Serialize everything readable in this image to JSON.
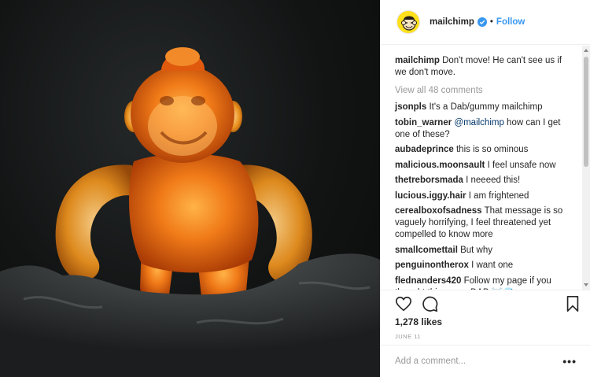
{
  "post": {
    "username": "mailchimp",
    "follow_label": "Follow",
    "dot": "•",
    "caption": {
      "user": "mailchimp",
      "text": " Don't move! He can't see us if we don't move."
    },
    "view_all": "View all 48 comments",
    "comments": [
      {
        "user": "jsonpls",
        "text": " It's a Dab/gummy mailchimp"
      },
      {
        "user": "tobin_warner",
        "mention": " @mailchimp",
        "text": " how can I get one of these?"
      },
      {
        "user": "aubadeprince",
        "text": " this is so ominous"
      },
      {
        "user": "malicious.moonsault",
        "text": " I feel unsafe now"
      },
      {
        "user": "thetrebors​mada",
        "text": " I neeeed this!"
      },
      {
        "user": "lucious.iggy.hair",
        "text": " I am frightened"
      },
      {
        "user": "cerealboxofsadness",
        "text": " That message is so vaguely horrifying, I feel threatened yet compelled to know more"
      },
      {
        "user": "smallcomettail",
        "text": " But why"
      },
      {
        "user": "penguinontherox",
        "text": " I want one"
      },
      {
        "user": "flednanders420",
        "text": " Follow my page if you thought this was a DAB ☠️💎"
      }
    ],
    "likes": "1,278 likes",
    "date": "JUNE 11",
    "comment_placeholder": "Add a comment...",
    "more_label": "•••"
  },
  "icons": {
    "like": "heart-icon",
    "comment": "comment-icon",
    "save": "bookmark-icon",
    "verified": "verified-badge-icon"
  },
  "colors": {
    "link": "#3897f0",
    "muted": "#999999",
    "verified": "#3897f0",
    "image_bg": "#121414",
    "figure": "#e86a12"
  }
}
